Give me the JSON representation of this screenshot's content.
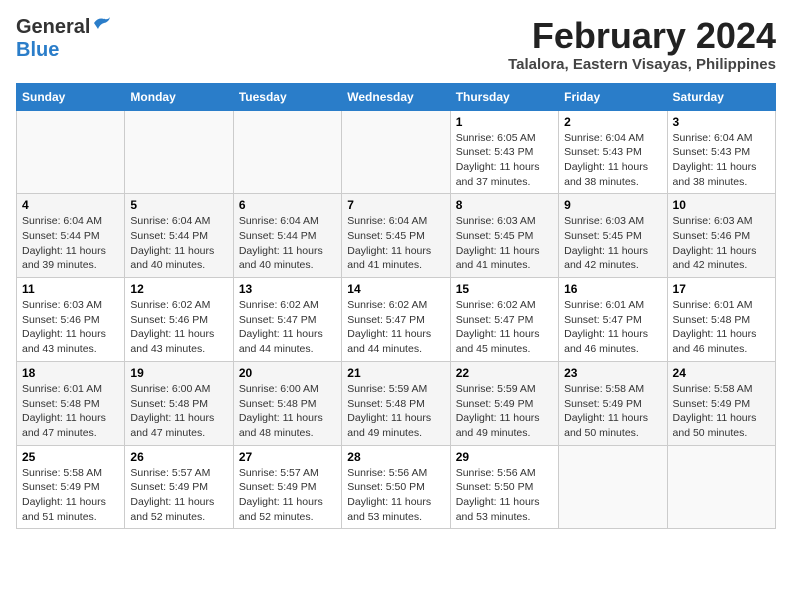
{
  "header": {
    "logo_general": "General",
    "logo_blue": "Blue",
    "title_month": "February 2024",
    "title_location": "Talalora, Eastern Visayas, Philippines"
  },
  "weekdays": [
    "Sunday",
    "Monday",
    "Tuesday",
    "Wednesday",
    "Thursday",
    "Friday",
    "Saturday"
  ],
  "weeks": [
    [
      {
        "day": "",
        "info": ""
      },
      {
        "day": "",
        "info": ""
      },
      {
        "day": "",
        "info": ""
      },
      {
        "day": "",
        "info": ""
      },
      {
        "day": "1",
        "info": "Sunrise: 6:05 AM\nSunset: 5:43 PM\nDaylight: 11 hours\nand 37 minutes."
      },
      {
        "day": "2",
        "info": "Sunrise: 6:04 AM\nSunset: 5:43 PM\nDaylight: 11 hours\nand 38 minutes."
      },
      {
        "day": "3",
        "info": "Sunrise: 6:04 AM\nSunset: 5:43 PM\nDaylight: 11 hours\nand 38 minutes."
      }
    ],
    [
      {
        "day": "4",
        "info": "Sunrise: 6:04 AM\nSunset: 5:44 PM\nDaylight: 11 hours\nand 39 minutes."
      },
      {
        "day": "5",
        "info": "Sunrise: 6:04 AM\nSunset: 5:44 PM\nDaylight: 11 hours\nand 40 minutes."
      },
      {
        "day": "6",
        "info": "Sunrise: 6:04 AM\nSunset: 5:44 PM\nDaylight: 11 hours\nand 40 minutes."
      },
      {
        "day": "7",
        "info": "Sunrise: 6:04 AM\nSunset: 5:45 PM\nDaylight: 11 hours\nand 41 minutes."
      },
      {
        "day": "8",
        "info": "Sunrise: 6:03 AM\nSunset: 5:45 PM\nDaylight: 11 hours\nand 41 minutes."
      },
      {
        "day": "9",
        "info": "Sunrise: 6:03 AM\nSunset: 5:45 PM\nDaylight: 11 hours\nand 42 minutes."
      },
      {
        "day": "10",
        "info": "Sunrise: 6:03 AM\nSunset: 5:46 PM\nDaylight: 11 hours\nand 42 minutes."
      }
    ],
    [
      {
        "day": "11",
        "info": "Sunrise: 6:03 AM\nSunset: 5:46 PM\nDaylight: 11 hours\nand 43 minutes."
      },
      {
        "day": "12",
        "info": "Sunrise: 6:02 AM\nSunset: 5:46 PM\nDaylight: 11 hours\nand 43 minutes."
      },
      {
        "day": "13",
        "info": "Sunrise: 6:02 AM\nSunset: 5:47 PM\nDaylight: 11 hours\nand 44 minutes."
      },
      {
        "day": "14",
        "info": "Sunrise: 6:02 AM\nSunset: 5:47 PM\nDaylight: 11 hours\nand 44 minutes."
      },
      {
        "day": "15",
        "info": "Sunrise: 6:02 AM\nSunset: 5:47 PM\nDaylight: 11 hours\nand 45 minutes."
      },
      {
        "day": "16",
        "info": "Sunrise: 6:01 AM\nSunset: 5:47 PM\nDaylight: 11 hours\nand 46 minutes."
      },
      {
        "day": "17",
        "info": "Sunrise: 6:01 AM\nSunset: 5:48 PM\nDaylight: 11 hours\nand 46 minutes."
      }
    ],
    [
      {
        "day": "18",
        "info": "Sunrise: 6:01 AM\nSunset: 5:48 PM\nDaylight: 11 hours\nand 47 minutes."
      },
      {
        "day": "19",
        "info": "Sunrise: 6:00 AM\nSunset: 5:48 PM\nDaylight: 11 hours\nand 47 minutes."
      },
      {
        "day": "20",
        "info": "Sunrise: 6:00 AM\nSunset: 5:48 PM\nDaylight: 11 hours\nand 48 minutes."
      },
      {
        "day": "21",
        "info": "Sunrise: 5:59 AM\nSunset: 5:48 PM\nDaylight: 11 hours\nand 49 minutes."
      },
      {
        "day": "22",
        "info": "Sunrise: 5:59 AM\nSunset: 5:49 PM\nDaylight: 11 hours\nand 49 minutes."
      },
      {
        "day": "23",
        "info": "Sunrise: 5:58 AM\nSunset: 5:49 PM\nDaylight: 11 hours\nand 50 minutes."
      },
      {
        "day": "24",
        "info": "Sunrise: 5:58 AM\nSunset: 5:49 PM\nDaylight: 11 hours\nand 50 minutes."
      }
    ],
    [
      {
        "day": "25",
        "info": "Sunrise: 5:58 AM\nSunset: 5:49 PM\nDaylight: 11 hours\nand 51 minutes."
      },
      {
        "day": "26",
        "info": "Sunrise: 5:57 AM\nSunset: 5:49 PM\nDaylight: 11 hours\nand 52 minutes."
      },
      {
        "day": "27",
        "info": "Sunrise: 5:57 AM\nSunset: 5:49 PM\nDaylight: 11 hours\nand 52 minutes."
      },
      {
        "day": "28",
        "info": "Sunrise: 5:56 AM\nSunset: 5:50 PM\nDaylight: 11 hours\nand 53 minutes."
      },
      {
        "day": "29",
        "info": "Sunrise: 5:56 AM\nSunset: 5:50 PM\nDaylight: 11 hours\nand 53 minutes."
      },
      {
        "day": "",
        "info": ""
      },
      {
        "day": "",
        "info": ""
      }
    ]
  ]
}
